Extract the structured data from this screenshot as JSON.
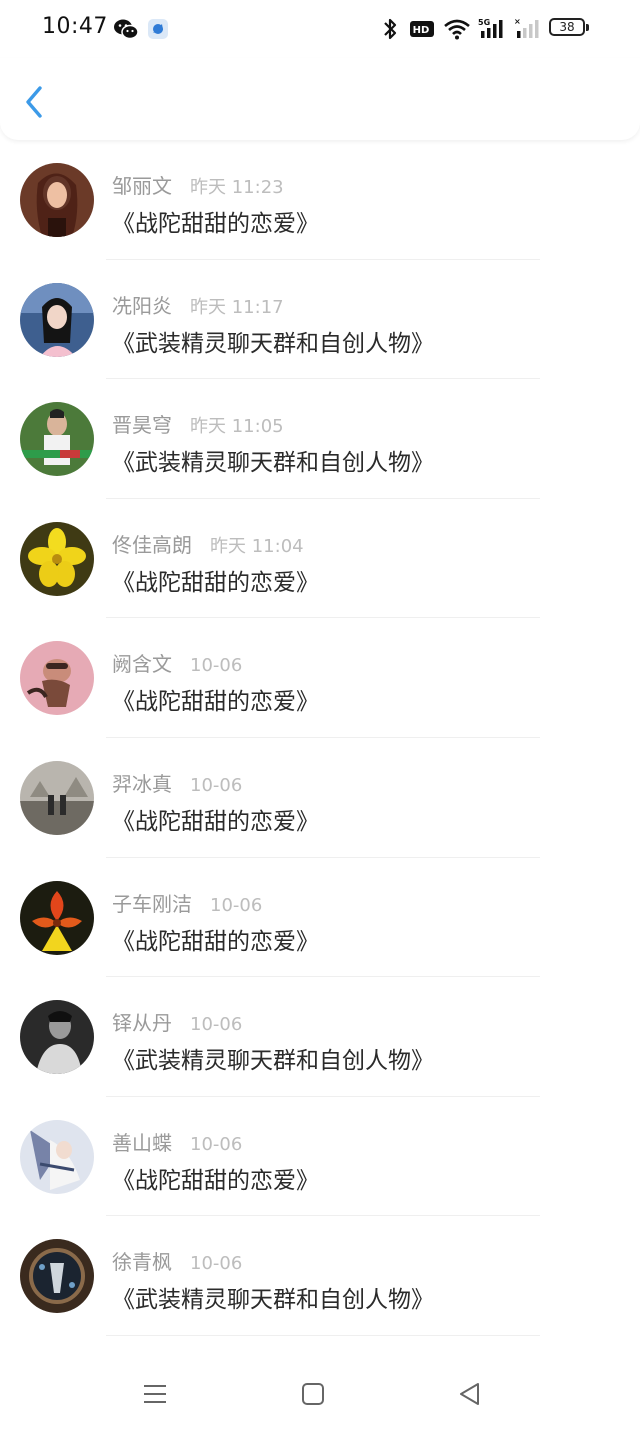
{
  "status_bar": {
    "time": "10:47",
    "battery": "38",
    "network_label": "5G",
    "hd_label": "HD"
  },
  "header": {
    "back_icon": "chevron-left-icon",
    "accent_color": "#3c9ae8"
  },
  "items": [
    {
      "name": "邹丽文",
      "time": "昨天 11:23",
      "title": "《战陀甜甜的恋爱》"
    },
    {
      "name": "冼阳炎",
      "time": "昨天 11:17",
      "title": "《武装精灵聊天群和自创人物》"
    },
    {
      "name": "晋昊穹",
      "time": "昨天 11:05",
      "title": "《武装精灵聊天群和自创人物》"
    },
    {
      "name": "佟佳高朗",
      "time": "昨天 11:04",
      "title": "《战陀甜甜的恋爱》"
    },
    {
      "name": "阙含文",
      "time": "10-06",
      "title": "《战陀甜甜的恋爱》"
    },
    {
      "name": "羿冰真",
      "time": "10-06",
      "title": "《战陀甜甜的恋爱》"
    },
    {
      "name": "子车刚洁",
      "time": "10-06",
      "title": "《战陀甜甜的恋爱》"
    },
    {
      "name": "铎从丹",
      "time": "10-06",
      "title": "《武装精灵聊天群和自创人物》"
    },
    {
      "name": "善山蝶",
      "time": "10-06",
      "title": "《战陀甜甜的恋爱》"
    },
    {
      "name": "徐青枫",
      "time": "10-06",
      "title": "《武装精灵聊天群和自创人物》"
    }
  ],
  "nav": {
    "menu_icon": "menu-icon",
    "home_icon": "home-icon",
    "back_icon": "triangle-back-icon"
  }
}
